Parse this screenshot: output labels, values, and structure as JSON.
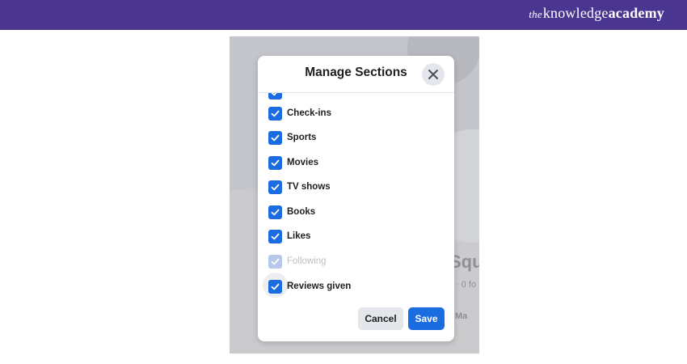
{
  "brand": {
    "prefix": "the",
    "name_regular": "knowledge",
    "name_bold": "academy"
  },
  "background": {
    "partial_title": "Squ",
    "partial_sub": "· 0 fo",
    "partial_action": "Ma"
  },
  "dialog": {
    "title": "Manage Sections",
    "close_label": "Close",
    "items": [
      {
        "label": "",
        "checked": true,
        "disabled": false
      },
      {
        "label": "Check-ins",
        "checked": true,
        "disabled": false
      },
      {
        "label": "Sports",
        "checked": true,
        "disabled": false
      },
      {
        "label": "Movies",
        "checked": true,
        "disabled": false
      },
      {
        "label": "TV shows",
        "checked": true,
        "disabled": false
      },
      {
        "label": "Books",
        "checked": true,
        "disabled": false
      },
      {
        "label": "Likes",
        "checked": true,
        "disabled": false
      },
      {
        "label": "Following",
        "checked": true,
        "disabled": true
      },
      {
        "label": "Reviews given",
        "checked": true,
        "disabled": false
      }
    ],
    "cancel_label": "Cancel",
    "save_label": "Save"
  },
  "colors": {
    "header": "#4a3691",
    "checkbox": "#1b6ce1",
    "checkbox_disabled": "#b7c9eb",
    "save_button": "#1b6ce1"
  }
}
